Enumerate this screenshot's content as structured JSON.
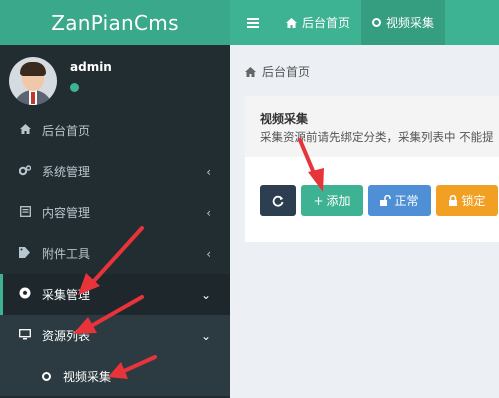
{
  "app": {
    "brand": "ZanPianCms"
  },
  "topbar": {
    "tabs": [
      {
        "label": "后台首页"
      },
      {
        "label": "视频采集"
      }
    ]
  },
  "user": {
    "name": "admin"
  },
  "sidebar": {
    "items": [
      {
        "label": "后台首页"
      },
      {
        "label": "系统管理"
      },
      {
        "label": "内容管理"
      },
      {
        "label": "附件工具"
      },
      {
        "label": "采集管理"
      },
      {
        "label": "资源列表"
      },
      {
        "label": "视频采集"
      }
    ]
  },
  "breadcrumb": {
    "label": "后台首页"
  },
  "box": {
    "title": "视频采集",
    "description": "采集资源前请先绑定分类，采集列表中 不能提",
    "buttons": {
      "add": "添加",
      "normal": "正常",
      "lock": "锁定"
    }
  },
  "colors": {
    "brand": "#3aa88a",
    "topbar": "#3eb393",
    "sidebar": "#222d32",
    "annotation_arrow": "#e8333a"
  }
}
